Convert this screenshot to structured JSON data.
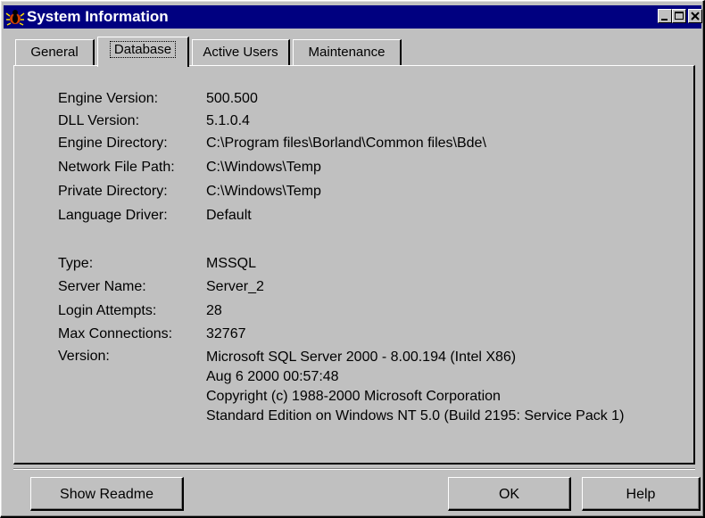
{
  "window": {
    "title": "System Information",
    "title_icon": "bug-app-icon",
    "controls": [
      "minimize",
      "maximize",
      "close"
    ]
  },
  "tabs": [
    {
      "label": "General",
      "active": false
    },
    {
      "label": "Database",
      "active": true
    },
    {
      "label": "Active Users",
      "active": false
    },
    {
      "label": "Maintenance",
      "active": false
    }
  ],
  "database": {
    "engine_version": {
      "label": "Engine Version:",
      "value": "500.500"
    },
    "dll_version": {
      "label": "DLL Version:",
      "value": "5.1.0.4"
    },
    "engine_directory": {
      "label": "Engine Directory:",
      "value": "C:\\Program files\\Borland\\Common files\\Bde\\"
    },
    "network_file_path": {
      "label": "Network File Path:",
      "value": "C:\\Windows\\Temp"
    },
    "private_directory": {
      "label": "Private Directory:",
      "value": "C:\\Windows\\Temp"
    },
    "language_driver": {
      "label": "Language Driver:",
      "value": "Default"
    },
    "type": {
      "label": "Type:",
      "value": "MSSQL"
    },
    "server_name": {
      "label": "Server Name:",
      "value": "Server_2"
    },
    "login_attempts": {
      "label": "Login Attempts:",
      "value": "28"
    },
    "max_connections": {
      "label": "Max Connections:",
      "value": "32767"
    },
    "version": {
      "label": "Version:",
      "lines": [
        "Microsoft SQL Server  2000 - 8.00.194 (Intel X86)",
        "Aug  6 2000 00:57:48",
        "Copyright (c) 1988-2000 Microsoft Corporation",
        "Standard Edition on Windows NT 5.0 (Build 2195: Service Pack 1)"
      ]
    }
  },
  "buttons": {
    "show_readme": "Show Readme",
    "ok": "OK",
    "help": "Help"
  },
  "colors": {
    "titlebar": "#000080",
    "face": "#c0c0c0"
  }
}
